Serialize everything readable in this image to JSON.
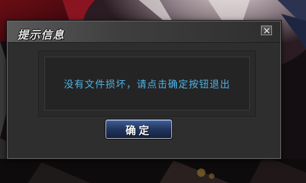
{
  "dialog": {
    "title": "提示信息",
    "message": "没有文件损坏，请点击确定按钮退出",
    "ok_label": "确定",
    "close_icon": "close-icon"
  },
  "colors": {
    "message_text": "#4fb3e8",
    "button_fill": "#22355e",
    "dialog_bg": "#2e2e2e"
  }
}
